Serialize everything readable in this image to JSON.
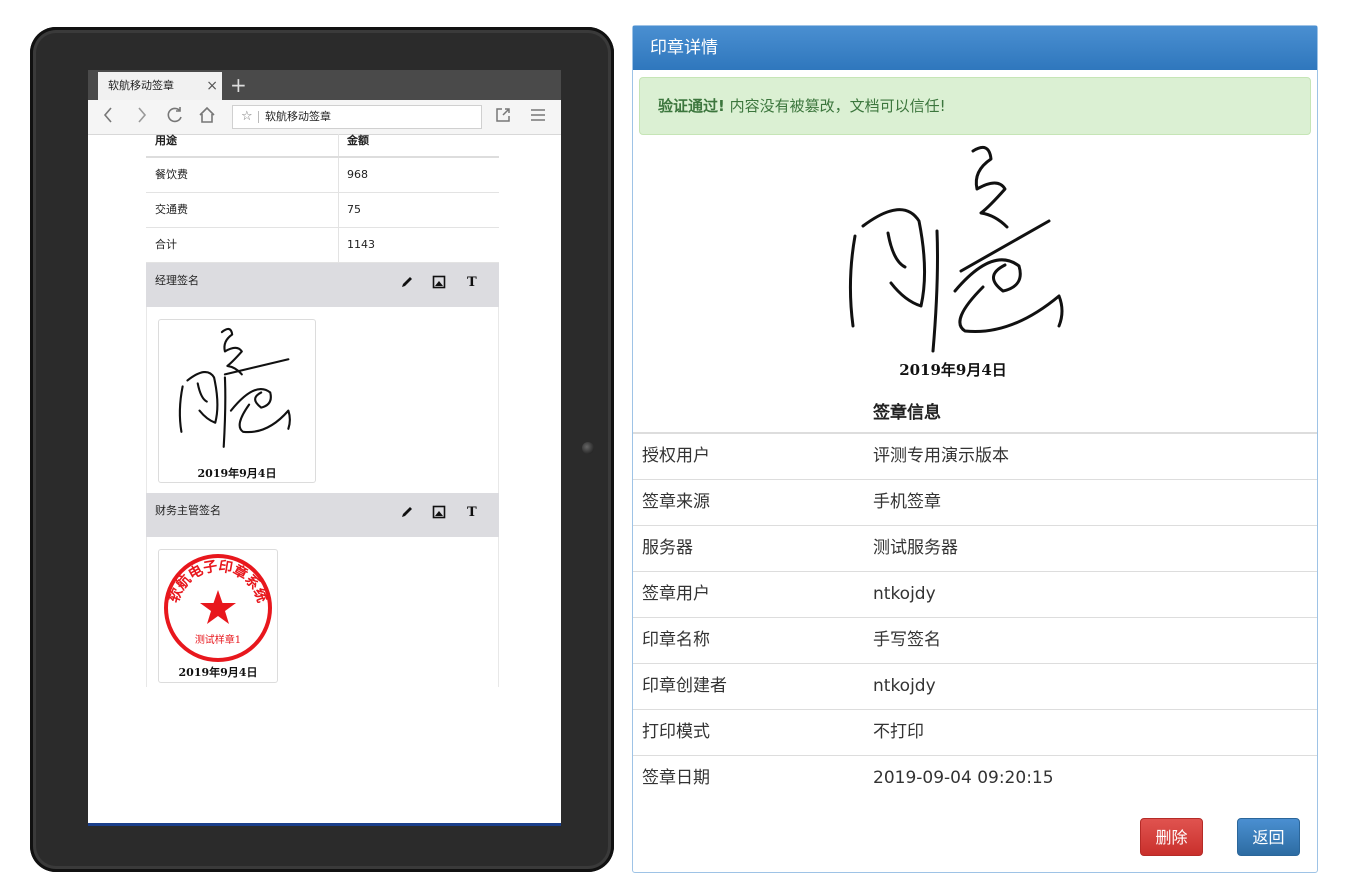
{
  "browser": {
    "tab_title": "软航移动签章",
    "tab_close": "×",
    "tab_new": "+",
    "url_text": "软航移动签章"
  },
  "document": {
    "header": {
      "col1": "用途",
      "col2": "金额"
    },
    "rows": [
      {
        "label": "餐饮费",
        "amount": "968"
      },
      {
        "label": "交通费",
        "amount": "75"
      },
      {
        "label": "合计",
        "amount": "1143"
      }
    ],
    "sections": [
      {
        "label": "经理签名",
        "date": "2019年9月4日"
      },
      {
        "label": "财务主管签名",
        "date": "2019年9月4日",
        "seal_text": "软航电子印章系统",
        "seal_sub": "测试样章1"
      }
    ],
    "tool_text": "T"
  },
  "detail": {
    "title": "印章详情",
    "alert_strong": "验证通过!",
    "alert_text": "内容没有被篡改，文档可以信任!",
    "signature_date": "2019年9月4日",
    "info_title": "签章信息",
    "info": [
      {
        "key": "授权用户",
        "value": "评测专用演示版本"
      },
      {
        "key": "签章来源",
        "value": "手机签章"
      },
      {
        "key": "服务器",
        "value": "测试服务器"
      },
      {
        "key": "签章用户",
        "value": "ntkojdy"
      },
      {
        "key": "印章名称",
        "value": "手写签名"
      },
      {
        "key": "印章创建者",
        "value": "ntkojdy"
      },
      {
        "key": "打印模式",
        "value": "不打印"
      },
      {
        "key": "签章日期",
        "value": "2019-09-04 09:20:15"
      }
    ],
    "delete_label": "删除",
    "back_label": "返回"
  },
  "colors": {
    "panel_header": "#2f77bd",
    "alert_bg": "#dbf0d3",
    "alert_text": "#3c763d",
    "delete_button": "#c9302c",
    "back_button": "#2d6ca2",
    "seal_red": "#e8171d"
  },
  "icons": {
    "nav": [
      "back-icon",
      "forward-icon",
      "reload-icon",
      "home-icon",
      "star-icon",
      "share-icon",
      "menu-icon"
    ],
    "tools": [
      "pen-icon",
      "image-icon",
      "text-icon"
    ]
  }
}
